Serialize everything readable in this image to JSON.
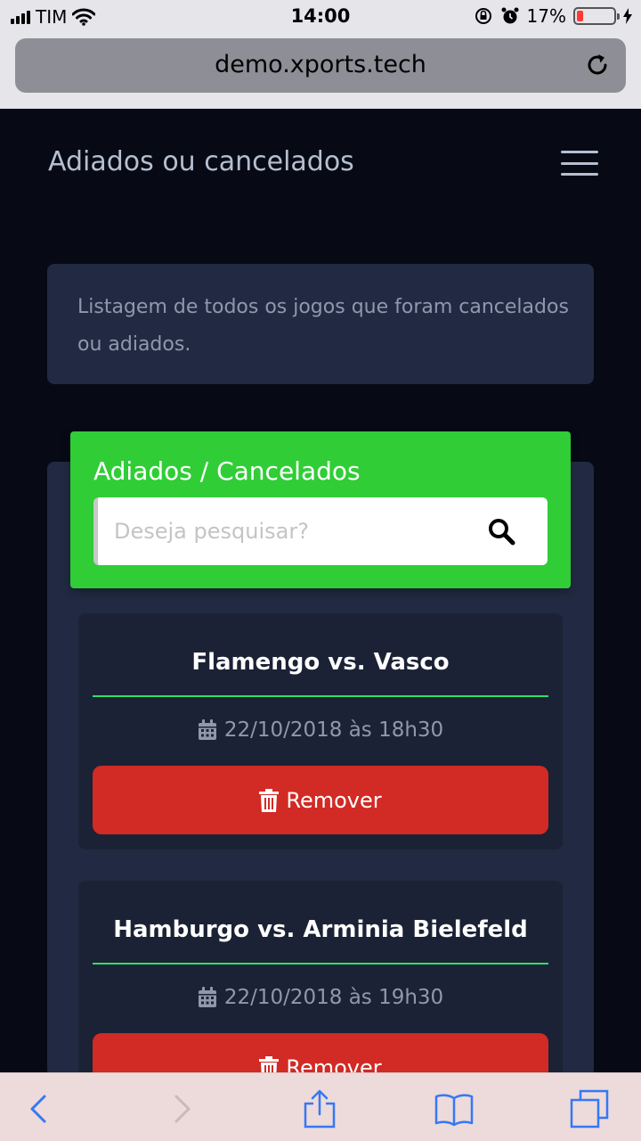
{
  "status_bar": {
    "carrier": "TIM",
    "time": "14:00",
    "battery_percent": "17%"
  },
  "browser": {
    "url": "demo.xports.tech"
  },
  "header": {
    "title": "Adiados ou cancelados"
  },
  "intro": {
    "text": "Listagem de todos os jogos que foram cancelados ou adiados."
  },
  "panel": {
    "title": "Adiados / Cancelados",
    "search_placeholder": "Deseja pesquisar?",
    "search_value": ""
  },
  "games": [
    {
      "title": "Flamengo vs. Vasco",
      "date": "22/10/2018 às 18h30",
      "remove_label": "Remover"
    },
    {
      "title": "Hamburgo vs. Arminia Bielefeld",
      "date": "22/10/2018 às 19h30",
      "remove_label": "Remover"
    }
  ],
  "colors": {
    "background": "#070a15",
    "card": "#212a42",
    "green_header": "#30cd37",
    "remove_button": "#d22a24",
    "divider": "#2ee06a",
    "ios_blue": "#3478f6"
  },
  "icons": {
    "menu": "hamburger-icon",
    "search": "search-icon",
    "calendar": "calendar-icon",
    "trash": "trash-icon",
    "reload": "reload-icon"
  }
}
